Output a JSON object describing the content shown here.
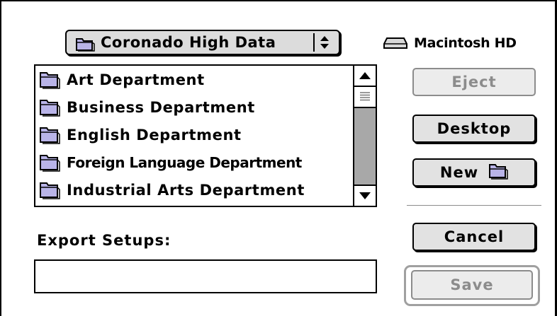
{
  "popup": {
    "label": "Coronado High Data",
    "icon": "folder-icon"
  },
  "volume": {
    "label": "Macintosh HD",
    "icon": "hard-drive-icon"
  },
  "file_list": {
    "items": [
      {
        "label": "Art Department",
        "icon": "folder-icon"
      },
      {
        "label": "Business Department",
        "icon": "folder-icon"
      },
      {
        "label": "English Department",
        "icon": "folder-icon"
      },
      {
        "label": "Foreign Language Department",
        "icon": "folder-icon"
      },
      {
        "label": "Industrial Arts Department",
        "icon": "folder-icon"
      }
    ]
  },
  "buttons": {
    "eject": "Eject",
    "desktop": "Desktop",
    "new": "New",
    "cancel": "Cancel",
    "save": "Save"
  },
  "export": {
    "label": "Export Setups:",
    "value": ""
  }
}
